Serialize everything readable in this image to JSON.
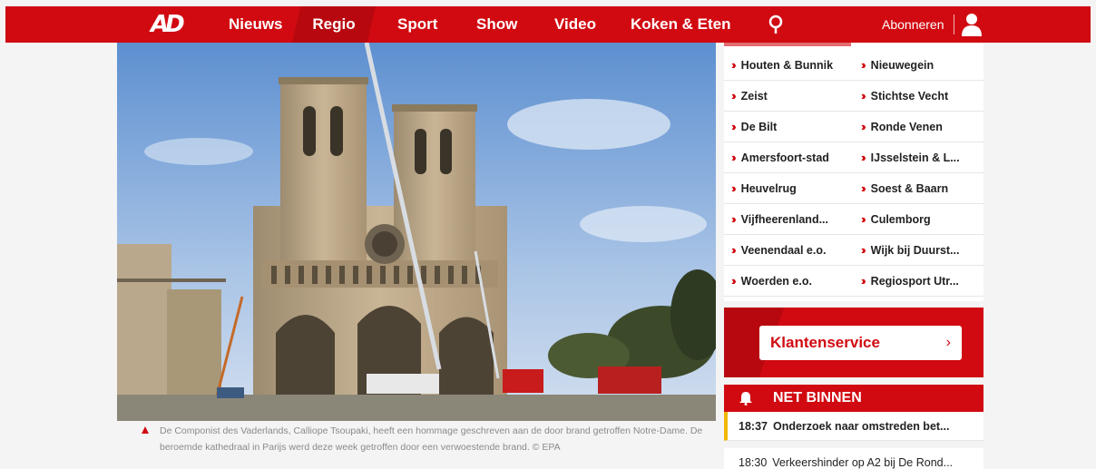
{
  "header": {
    "logo": "AD",
    "nav": [
      {
        "label": "Nieuws"
      },
      {
        "label": "Regio"
      },
      {
        "label": "Sport"
      },
      {
        "label": "Show"
      },
      {
        "label": "Video"
      },
      {
        "label": "Koken & Eten"
      }
    ],
    "subscribe_label": "Abonneren",
    "brand_color": "#d10a11"
  },
  "hero": {
    "caption": "De Componist des Vaderlands, Calliope Tsoupaki, heeft een hommage geschreven aan de door brand getroffen Notre-Dame. De beroemde kathedraal in Parijs werd deze week getroffen door een verwoestende brand. © EPA"
  },
  "regions": {
    "items": [
      {
        "label": "Houten & Bunnik"
      },
      {
        "label": "Nieuwegein"
      },
      {
        "label": "Zeist"
      },
      {
        "label": "Stichtse Vecht"
      },
      {
        "label": "De Bilt"
      },
      {
        "label": "Ronde Venen"
      },
      {
        "label": "Amersfoort-stad"
      },
      {
        "label": "IJsselstein & L..."
      },
      {
        "label": "Heuvelrug"
      },
      {
        "label": "Soest & Baarn"
      },
      {
        "label": "Vijfheerenland..."
      },
      {
        "label": "Culemborg"
      },
      {
        "label": "Veenendaal e.o."
      },
      {
        "label": "Wijk bij Duurst..."
      },
      {
        "label": "Woerden e.o."
      },
      {
        "label": "Regiosport Utr..."
      }
    ]
  },
  "service": {
    "label": "Klantenservice",
    "chevron": "›"
  },
  "net_binnen": {
    "title": "NET BINNEN",
    "items": [
      {
        "time": "18:37",
        "title": "Onderzoek naar omstreden bet..."
      },
      {
        "time": "18:30",
        "title": "Verkeershinder op A2 bij De Rond..."
      }
    ]
  }
}
